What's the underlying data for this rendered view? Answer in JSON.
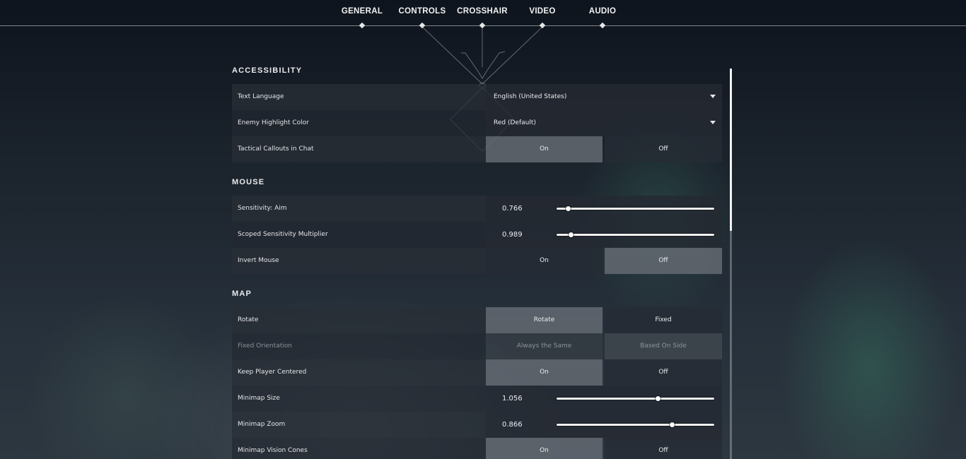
{
  "tabs": [
    "GENERAL",
    "CONTROLS",
    "CROSSHAIR",
    "VIDEO",
    "AUDIO"
  ],
  "accessibility": {
    "title": "ACCESSIBILITY",
    "text_language": {
      "label": "Text Language",
      "value": "English (United States)"
    },
    "enemy_highlight": {
      "label": "Enemy Highlight Color",
      "value": "Red (Default)"
    },
    "tactical_callouts": {
      "label": "Tactical Callouts in Chat",
      "on": "On",
      "off": "Off",
      "selected": "On"
    }
  },
  "mouse": {
    "title": "MOUSE",
    "sensitivity": {
      "label": "Sensitivity: Aim",
      "value": "0.766",
      "fill_fraction": 0.07
    },
    "scoped": {
      "label": "Scoped Sensitivity Multiplier",
      "value": "0.989",
      "fill_fraction": 0.09
    },
    "invert": {
      "label": "Invert Mouse",
      "on": "On",
      "off": "Off",
      "selected": "Off"
    }
  },
  "map": {
    "title": "MAP",
    "rotate": {
      "label": "Rotate",
      "on": "Rotate",
      "off": "Fixed",
      "selected": "Rotate"
    },
    "fixed_orientation": {
      "label": "Fixed Orientation",
      "on": "Always the Same",
      "off": "Based On Side",
      "disabled": true
    },
    "keep_centered": {
      "label": "Keep Player Centered",
      "on": "On",
      "off": "Off",
      "selected": "On"
    },
    "minimap_size": {
      "label": "Minimap Size",
      "value": "1.056",
      "fill_fraction": 0.64
    },
    "minimap_zoom": {
      "label": "Minimap Zoom",
      "value": "0.866",
      "fill_fraction": 0.73
    },
    "vision_cones": {
      "label": "Minimap Vision Cones",
      "on": "On",
      "off": "Off",
      "selected": "On"
    }
  },
  "colors": {
    "selected_toggle": "#62686f",
    "unselected_toggle": "#262c34",
    "accent_thumb": "#ffffff"
  }
}
